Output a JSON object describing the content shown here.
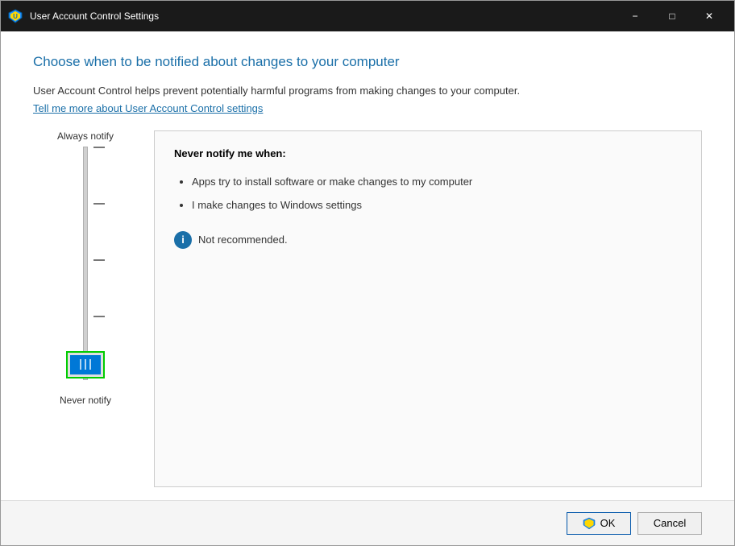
{
  "titlebar": {
    "title": "User Account Control Settings",
    "minimize_label": "−",
    "maximize_label": "□",
    "close_label": "✕"
  },
  "content": {
    "heading": "Choose when to be notified about changes to your computer",
    "description": "User Account Control helps prevent potentially harmful programs from making changes to your computer.",
    "link_text": "Tell me more about User Account Control settings",
    "slider": {
      "label_top": "Always notify",
      "label_bottom": "Never notify"
    },
    "info_panel": {
      "title": "Never notify me when:",
      "bullets": [
        "Apps try to install software or make changes to my computer",
        "I make changes to Windows settings"
      ],
      "note": "Not recommended."
    }
  },
  "footer": {
    "ok_label": "OK",
    "cancel_label": "Cancel"
  }
}
